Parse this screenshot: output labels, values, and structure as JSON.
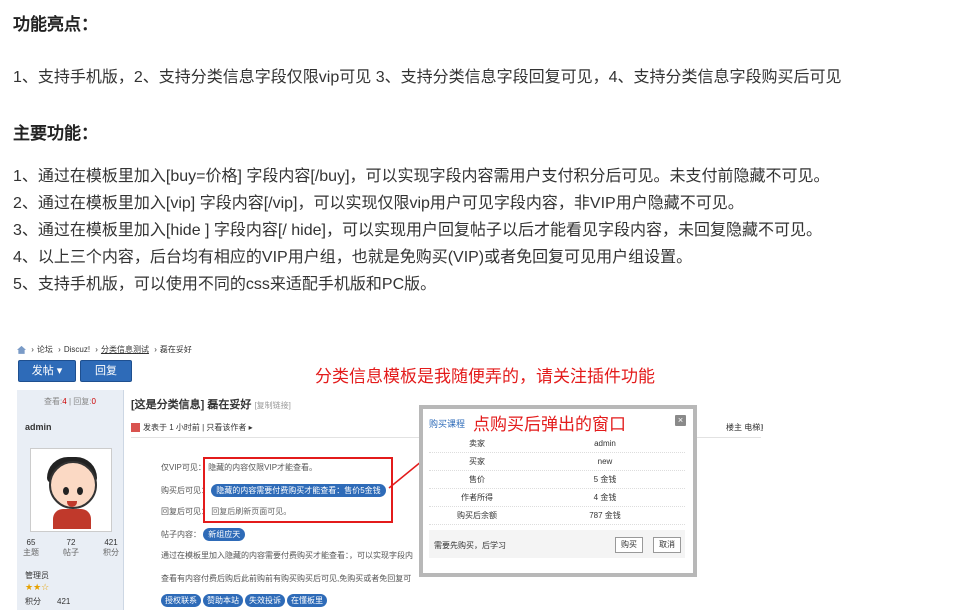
{
  "heading1": "功能亮点：",
  "highlight_line": "1、支持手机版，2、支持分类信息字段仅限vip可见 3、支持分类信息字段回复可见，4、支持分类信息字段购买后可见",
  "heading2": "主要功能：",
  "features": [
    "1、通过在模板里加入[buy=价格] 字段内容[/buy]，可以实现字段内容需用户支付积分后可见。未支付前隐藏不可见。",
    "2、通过在模板里加入[vip] 字段内容[/vip]，可以实现仅限vip用户可见字段内容，非VIP用户隐藏不可见。",
    "3、通过在模板里加入[hide ] 字段内容[/ hide]，可以实现用户回复帖子以后才能看见字段内容，未回复隐藏不可见。",
    "4、以上三个内容，后台均有相应的VIP用户组，也就是免购买(VIP)或者免回复可见用户组设置。",
    "5、支持手机版，可以使用不同的css来适配手机版和PC版。"
  ],
  "shot": {
    "breadcrumb": [
      "论坛",
      "Discuz!",
      "分类信息测试",
      "磊在妥好"
    ],
    "post_button": "发帖 ▾",
    "reply_button": "回复",
    "annotation_top": "分类信息模板是我随便弄的，请关注插件功能",
    "stats_views_label": "查看:",
    "stats_views": "4",
    "stats_replies_label": "回复:",
    "stats_replies": "0",
    "author": "admin",
    "counts": [
      {
        "num": "65",
        "label": "主题"
      },
      {
        "num": "72",
        "label": "帖子"
      },
      {
        "num": "421",
        "label": "积分"
      }
    ],
    "group": "管理员",
    "stars": "★★☆",
    "credit_label": "积分",
    "credit_value": "421",
    "thread_title": "[这是分类信息] 磊在妥好",
    "thread_sub": "[复制链接]",
    "meta": "发表于 1 小时前 | 只看该作者 ▸",
    "right_meta": "楼主  电梯直",
    "field_vip_label": "仅VIP可见：",
    "field_vip_text": "隐藏的内容仅限VIP才能查看。",
    "field_buy_label": "购买后可见：",
    "field_buy_text": "隐藏的内容需要付费购买才能查看：售价5金钱",
    "field_reply_label": "回复后可见：",
    "field_reply_text": "回复后刷新页面可见。",
    "field_content_label": "帖子内容：",
    "field_content_text": "新组应天",
    "line1": "通过在模板里加入隐藏的内容需要付费购买才能查看：，可以实现字段内",
    "line2": "查看有内容付费后购后此前购前有购买购买后可见,免购买或者免回复可",
    "tags": [
      "授权联系",
      "赞助本站",
      "失效投诉",
      "在懂板里"
    ],
    "popup_title": "购买课程",
    "popup_annotation": "点购买后弹出的窗口",
    "popup_close": "×",
    "popup_rows": [
      {
        "k": "卖家",
        "v": "admin"
      },
      {
        "k": "买家",
        "v": "new"
      },
      {
        "k": "售价",
        "v": "5 金钱"
      },
      {
        "k": "作者所得",
        "v": "4 金钱"
      },
      {
        "k": "购买后余额",
        "v": "787 金钱"
      }
    ],
    "popup_note": "需要先购买，后学习",
    "popup_buy": "购买",
    "popup_cancel": "取消"
  }
}
